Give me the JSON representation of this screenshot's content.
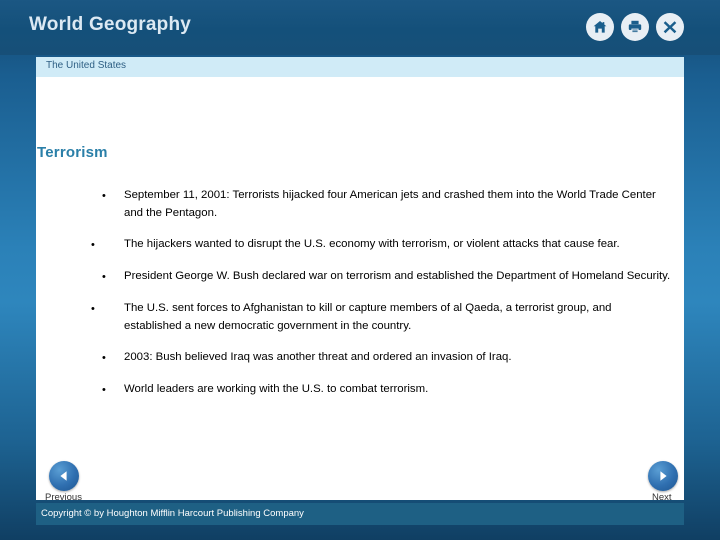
{
  "header": {
    "title": "World Geography",
    "icons": [
      {
        "name": "home-icon",
        "label": "Home"
      },
      {
        "name": "print-icon",
        "label": "Print"
      },
      {
        "name": "close-icon",
        "label": "Close"
      }
    ]
  },
  "subtitle": {
    "text": "The United States"
  },
  "body": {
    "heading": "Terrorism",
    "bullet_marker": "•",
    "bullets": [
      "September 11, 2001: Terrorists hijacked four American jets and crashed them into the World Trade Center and the Pentagon.",
      "The hijackers wanted to disrupt the U.S. economy with terrorism, or violent attacks that cause fear.",
      "President George W. Bush declared war on terrorism and established the Department of Homeland Security.",
      "The U.S. sent forces to Afghanistan to kill or capture members of al Qaeda, a terrorist group, and established a new democratic government in the country.",
      "2003: Bush believed Iraq was another threat and ordered an invasion of Iraq.",
      "World leaders are working with the U.S. to combat terrorism."
    ]
  },
  "footer": {
    "previous_label": "Previous",
    "next_label": "Next",
    "copyright": "Copyright © by Houghton Mifflin Harcourt Publishing Company"
  },
  "colors": {
    "header_blue": "#15527e",
    "frame_blue": "#2b81b8",
    "subtitle_bar": "#d0ebf7",
    "heading_teal": "#2a7fa8",
    "copyright_bar": "#1e6084",
    "nav_button": "#2f6fb0"
  }
}
